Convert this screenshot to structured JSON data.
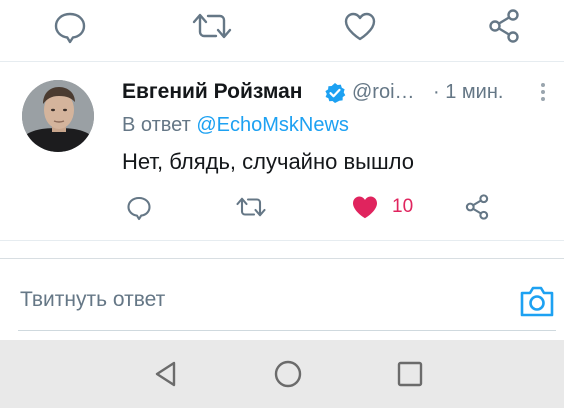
{
  "colors": {
    "accent": "#1da1f2",
    "like": "#e0245e",
    "secondary_text": "#657786",
    "nav_bar": "#e9e9e9"
  },
  "previous_tweet_actions": {
    "icons": [
      "reply-icon",
      "retweet-icon",
      "like-icon",
      "share-icon"
    ]
  },
  "tweet": {
    "author_name": "Евгений Ройзман",
    "verified": true,
    "handle": "@roi…",
    "time": "· 1 мин.",
    "reply_prefix": "В ответ",
    "reply_mention": "@EchoMskNews",
    "text": "Нет, блядь, случайно вышло",
    "like_count": "10",
    "liked": true
  },
  "composer": {
    "placeholder": "Твитнуть ответ"
  },
  "nav_bar": {
    "buttons": [
      "back-icon",
      "home-icon",
      "recents-icon"
    ]
  }
}
